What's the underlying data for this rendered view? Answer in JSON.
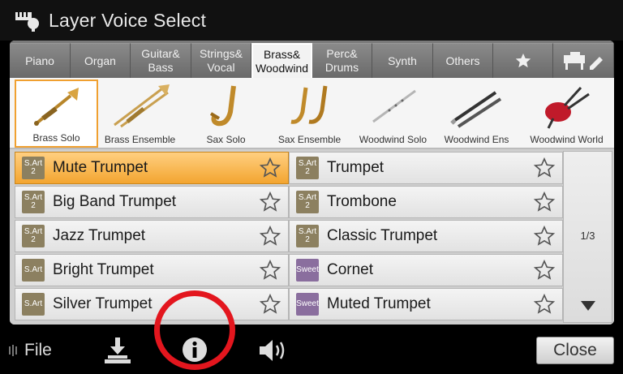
{
  "window": {
    "title": "Layer Voice Select"
  },
  "tabs": [
    {
      "label": "Piano",
      "active": false
    },
    {
      "label": "Organ",
      "active": false
    },
    {
      "label": "Guitar&\nBass",
      "active": false
    },
    {
      "label": "Strings&\nVocal",
      "active": false
    },
    {
      "label": "Brass&\nWoodwind",
      "active": true
    },
    {
      "label": "Perc&\nDrums",
      "active": false
    },
    {
      "label": "Synth",
      "active": false
    },
    {
      "label": "Others",
      "active": false
    }
  ],
  "categories": [
    {
      "label": "Brass Solo",
      "icon": "trumpet-icon",
      "selected": true
    },
    {
      "label": "Brass Ensemble",
      "icon": "trombone-icon",
      "selected": false
    },
    {
      "label": "Sax Solo",
      "icon": "saxophone-icon",
      "selected": false
    },
    {
      "label": "Sax Ensemble",
      "icon": "saxophones-icon",
      "selected": false
    },
    {
      "label": "Woodwind Solo",
      "icon": "flute-icon",
      "selected": false
    },
    {
      "label": "Woodwind Ens",
      "icon": "clarinets-icon",
      "selected": false
    },
    {
      "label": "Woodwind World",
      "icon": "bagpipe-icon",
      "selected": false
    }
  ],
  "voices": [
    {
      "name": "Mute Trumpet",
      "badge": "S.Art 2",
      "badge_top": "S.Art",
      "badge_bottom": "2",
      "type": "sart",
      "selected": true
    },
    {
      "name": "Trumpet",
      "badge": "S.Art 2",
      "badge_top": "S.Art",
      "badge_bottom": "2",
      "type": "sart",
      "selected": false
    },
    {
      "name": "Big Band Trumpet",
      "badge": "S.Art 2",
      "badge_top": "S.Art",
      "badge_bottom": "2",
      "type": "sart",
      "selected": false
    },
    {
      "name": "Trombone",
      "badge": "S.Art 2",
      "badge_top": "S.Art",
      "badge_bottom": "2",
      "type": "sart",
      "selected": false
    },
    {
      "name": "Jazz Trumpet",
      "badge": "S.Art 2",
      "badge_top": "S.Art",
      "badge_bottom": "2",
      "type": "sart",
      "selected": false
    },
    {
      "name": "Classic Trumpet",
      "badge": "S.Art 2",
      "badge_top": "S.Art",
      "badge_bottom": "2",
      "type": "sart",
      "selected": false
    },
    {
      "name": "Bright Trumpet",
      "badge": "S.Art",
      "badge_top": "S.Art",
      "badge_bottom": "",
      "type": "sart",
      "selected": false
    },
    {
      "name": "Cornet",
      "badge": "Sweet",
      "badge_top": "Sweet",
      "badge_bottom": "",
      "type": "sweet",
      "selected": false
    },
    {
      "name": "Silver Trumpet",
      "badge": "S.Art",
      "badge_top": "S.Art",
      "badge_bottom": "",
      "type": "sart",
      "selected": false
    },
    {
      "name": "Muted Trumpet",
      "badge": "Sweet",
      "badge_top": "Sweet",
      "badge_bottom": "",
      "type": "sweet",
      "selected": false
    }
  ],
  "pager": {
    "page": "1/3"
  },
  "bottom": {
    "file_label": "File",
    "close_label": "Close"
  },
  "colors": {
    "selection": "#f3a530",
    "annotation": "#e3161e"
  }
}
